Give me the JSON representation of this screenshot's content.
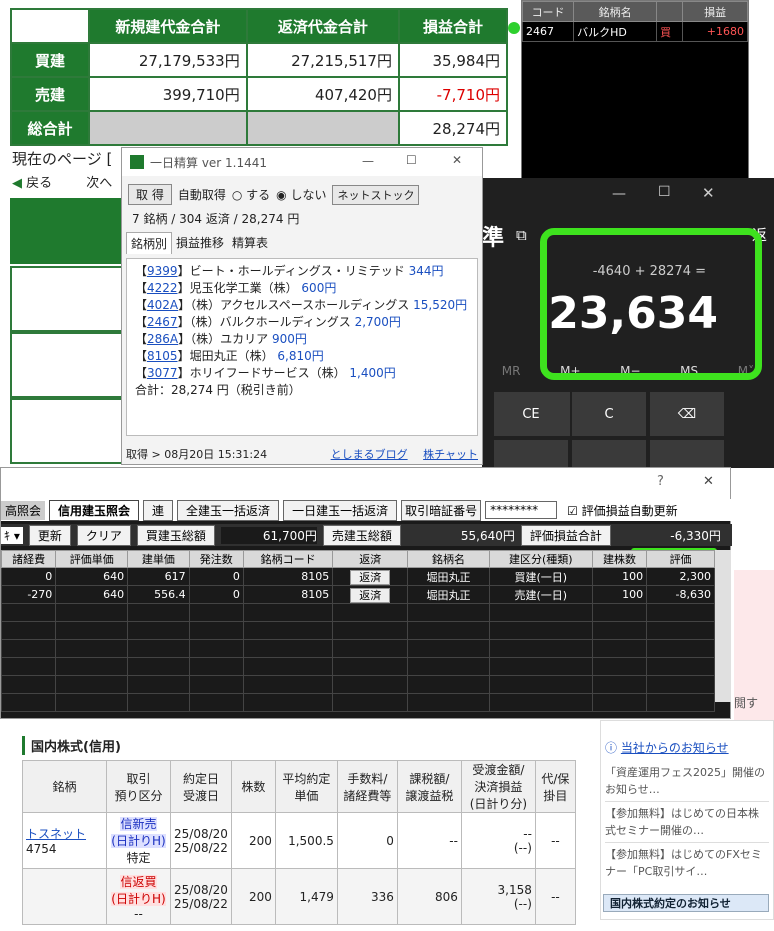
{
  "summary": {
    "headers": [
      "新規建代金合計",
      "返済代金合計",
      "損益合計"
    ],
    "rows": [
      {
        "label": "買建",
        "new": "27,179,533円",
        "ret": "27,215,517円",
        "pl": "35,984円"
      },
      {
        "label": "売建",
        "new": "399,710円",
        "ret": "407,420円",
        "pl": "-7,710円"
      },
      {
        "label": "総合計",
        "new": "",
        "ret": "",
        "pl": "28,274円"
      }
    ]
  },
  "mini": {
    "headers": [
      "コード",
      "銘柄名",
      "",
      "損益"
    ],
    "row": {
      "code": "2467",
      "name": "バルクHD",
      "side": "買",
      "pl": "+1680"
    }
  },
  "page": {
    "current": "現在のページ [",
    "prev": "戻る",
    "next": "次へ"
  },
  "calc": {
    "title_frag": "準",
    "expression": "-4640 + 28274 =",
    "result": "23,634",
    "mem": [
      "MR",
      "M+",
      "M−",
      "MS",
      "M˅"
    ],
    "keys": [
      "CE",
      "C",
      "⌫"
    ],
    "side_frag": "返"
  },
  "ichi": {
    "title": "一日精算 ver 1.1441",
    "btn_get": "取 得",
    "auto_label": "自動取得",
    "opt_on": "する",
    "opt_off": "しない",
    "net": "ネットストック",
    "stats": "7 銘柄 / 304 返済 / 28,274 円",
    "tabs": [
      "銘柄別",
      "損益推移",
      "精算表"
    ],
    "items": [
      {
        "code": "9399",
        "name": "ビート・ホールディングス・リミテッド",
        "amt": "344円"
      },
      {
        "code": "4222",
        "name": "児玉化学工業（株）",
        "amt": "600円"
      },
      {
        "code": "402A",
        "name": "（株）アクセルスペースホールディングス",
        "amt": "15,520円"
      },
      {
        "code": "2467",
        "name": "（株）バルクホールディングス",
        "amt": "2,700円"
      },
      {
        "code": "286A",
        "name": "（株）ユカリア",
        "amt": "900円"
      },
      {
        "code": "8105",
        "name": "堀田丸正（株）",
        "amt": "6,810円"
      },
      {
        "code": "3077",
        "name": "ホリイフードサービス（株）",
        "amt": "1,400円"
      }
    ],
    "total": "合計：28,274 円（税引き前）",
    "status": "取得 > 08月20日 15:31:24",
    "blog": "としまるブログ",
    "chart": "株チャット"
  },
  "trade": {
    "tabs": [
      "高照会",
      "信用建玉照会"
    ],
    "btns": [
      "連",
      "全建玉一括返済",
      "一日建玉一括返済",
      "取引暗証番号"
    ],
    "password": "********",
    "auto": "評価損益自動更新",
    "bar": {
      "upd": "更新",
      "clr": "クリア",
      "buy_lbl": "買建玉総額",
      "buy_val": "61,700円",
      "sell_lbl": "売建玉総額",
      "sell_val": "55,640円",
      "eval_lbl": "評価損益合計",
      "eval_val": "-6,330円"
    },
    "cols": [
      "諸経費",
      "評価単価",
      "建単価",
      "発注数",
      "銘柄コード",
      "返済",
      "銘柄名",
      "建区分(種類)",
      "建株数",
      "評価"
    ],
    "rows": [
      [
        "0",
        "640",
        "617",
        "0",
        "8105",
        "返済",
        "堀田丸正",
        "買建(一日)",
        "100",
        "2,300"
      ],
      [
        "-270",
        "640",
        "556.4",
        "0",
        "8105",
        "返済",
        "堀田丸正",
        "売建(一日)",
        "100",
        "-8,630"
      ]
    ]
  },
  "bottom": {
    "title": "国内株式(信用)",
    "headers": [
      "銘柄",
      "取引\n預り区分",
      "約定日\n受渡日",
      "株数",
      "平均約定\n単価",
      "手数料/\n諸経費等",
      "課税額/\n譲渡益税",
      "受渡金額/\n決済損益\n(日計り分)",
      "代/保\n掛目"
    ],
    "rows": [
      {
        "name": "トスネット",
        "code": "4754",
        "type": "信新売\n(日計りH)",
        "type2": "特定",
        "date": "25/08/20\n25/08/22",
        "qty": "200",
        "price": "1,500.5",
        "fee": "0",
        "tax": "--",
        "amt": "--\n(--)",
        "dai": "--"
      },
      {
        "name": "",
        "code": "",
        "type": "信返買\n(日計りH)",
        "type2": "--",
        "date": "25/08/20\n25/08/22",
        "qty": "200",
        "price": "1,479",
        "fee": "336",
        "tax": "806",
        "amt": "3,158\n(--)",
        "dai": "--"
      }
    ]
  },
  "side": {
    "link": "当社からのお知らせ",
    "news": [
      "「資産運用フェス2025」開催のお知らせ…",
      "【参加無料】はじめての日本株式セミナー開催の…",
      "【参加無料】はじめてのFXセミナー「PC取引サイ…"
    ],
    "footer": "国内株式約定のお知らせ",
    "frag": "閲す"
  }
}
